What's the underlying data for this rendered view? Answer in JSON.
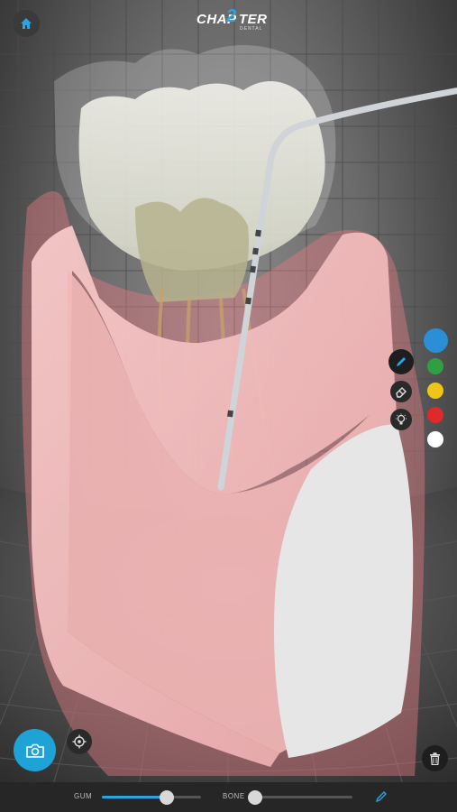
{
  "app": {
    "logo_text_left": "CHAP",
    "logo_number": "2",
    "logo_text_right": "TER",
    "logo_sub": "DENTAL"
  },
  "toolbar_right": {
    "tools": [
      {
        "name": "pencil-tool",
        "icon": "pencil-icon",
        "selected": true
      },
      {
        "name": "eraser-tool",
        "icon": "eraser-icon"
      },
      {
        "name": "lightbulb-tool",
        "icon": "lightbulb-icon"
      }
    ],
    "colors": [
      {
        "name": "blue",
        "hex": "#2b8fd6",
        "selected": true
      },
      {
        "name": "green",
        "hex": "#2ea043"
      },
      {
        "name": "yellow",
        "hex": "#f0c419"
      },
      {
        "name": "red",
        "hex": "#e02a2a"
      },
      {
        "name": "white",
        "hex": "#ffffff"
      }
    ]
  },
  "bottom_bar": {
    "gum_label": "GUM",
    "gum_value": 0.65,
    "bone_label": "BONE",
    "bone_value": 0.04
  },
  "accent": "#1fa3d6"
}
